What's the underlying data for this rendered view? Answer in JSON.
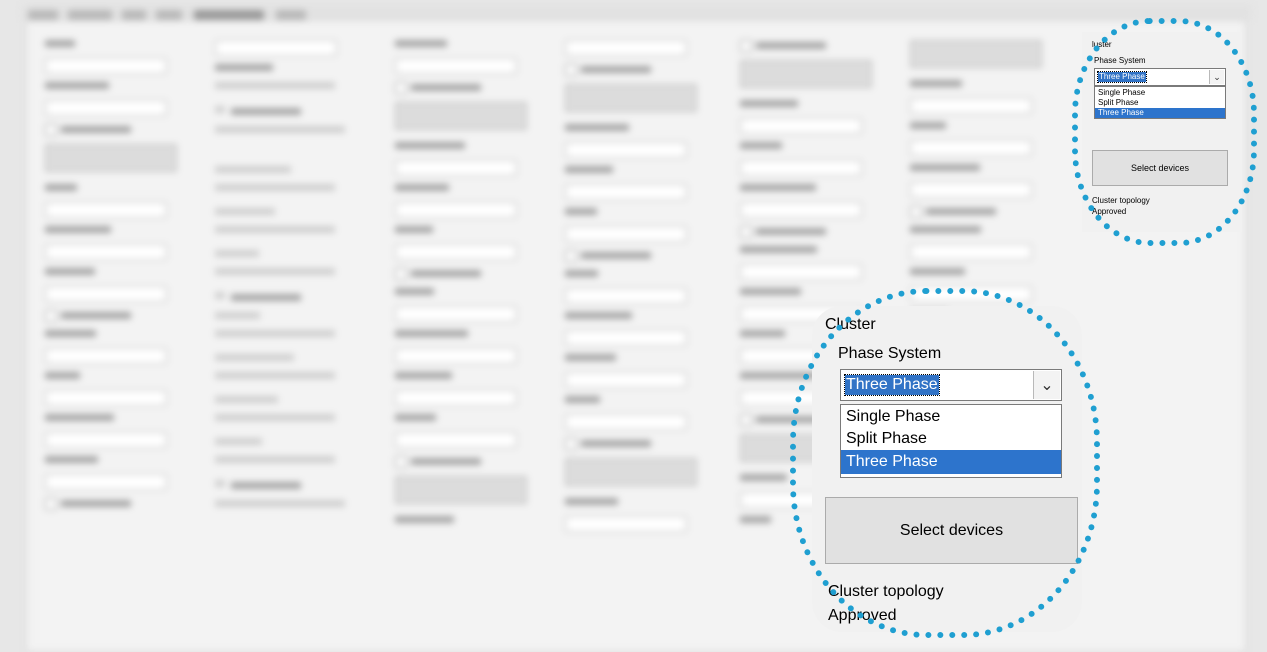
{
  "colors": {
    "callout_border": "#1f9fd1",
    "selection_bg": "#3173c6",
    "highlight_bg": "#2d74cc",
    "button_bg": "#e1e1e1",
    "panel_bg": "#f0f0f0"
  },
  "icons": {
    "dropdown_arrow": "chevron-down-icon"
  },
  "cluster": {
    "group_label": "Cluster",
    "phase_label": "Phase System",
    "phase_value": "Three Phase",
    "phase_options": [
      "Single Phase",
      "Split Phase",
      "Three Phase"
    ],
    "highlighted_option": "Three Phase",
    "select_button": "Select devices",
    "topology_label": "Cluster topology",
    "topology_status": "Approved"
  },
  "cluster_small": {
    "group_label": "luster",
    "phase_label": "Phase System",
    "phase_value": "Three Phase",
    "phase_options": [
      "Single Phase",
      "Split Phase",
      "Three Phase"
    ],
    "select_button": "Select devices",
    "topology_label": "Cluster topology",
    "topology_status": "Approved"
  }
}
